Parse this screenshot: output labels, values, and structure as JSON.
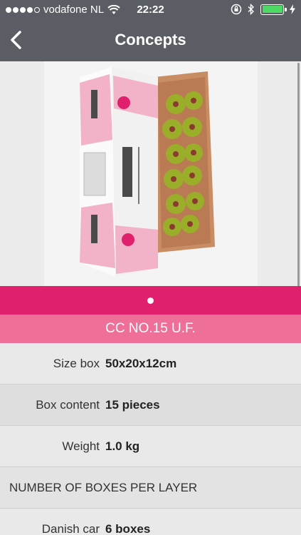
{
  "status_bar": {
    "carrier": "vodafone NL",
    "time": "22:22",
    "battery_color": "#4cd964"
  },
  "nav": {
    "back_icon": "chevron-left-icon",
    "title": "Concepts"
  },
  "gallery": {
    "image": "flower-box-photo",
    "page_dots": 1,
    "active_dot": 1,
    "pager_color": "#e0206c"
  },
  "product": {
    "name": "CC NO.15 U.F.",
    "band_color": "#ee6f98"
  },
  "details": [
    {
      "label": "Size box",
      "value": "50x20x12cm"
    },
    {
      "label": "Box content",
      "value": "15 pieces"
    },
    {
      "label": "Weight",
      "value": "1.0 kg"
    }
  ],
  "section_header": "NUMBER OF BOXES PER LAYER",
  "layers": [
    {
      "label": "Danish car",
      "value": "6 boxes"
    }
  ]
}
